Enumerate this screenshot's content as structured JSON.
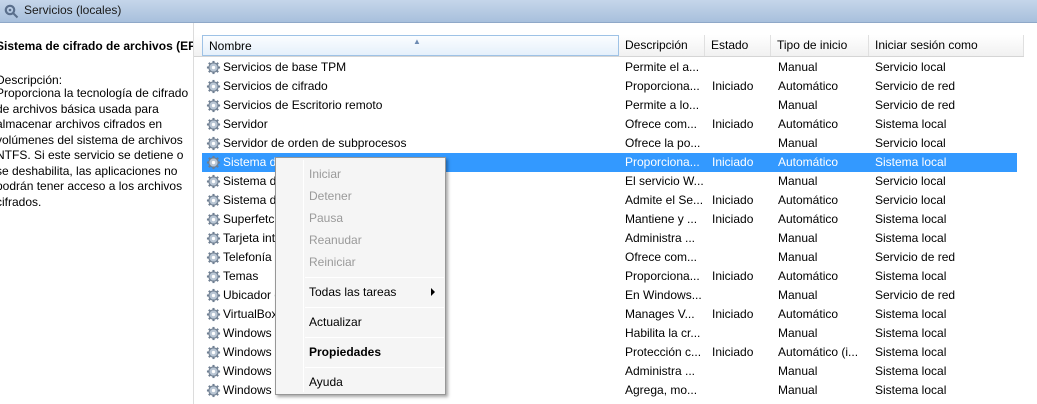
{
  "header": {
    "title": "Servicios (locales)"
  },
  "left_pane": {
    "service_title": "Sistema de cifrado de archivos (EFS)",
    "description_label": "Descripción:",
    "description_text": "Proporciona la tecnología de cifrado de archivos básica usada para almacenar archivos cifrados en volúmenes del sistema de archivos NTFS. Si este servicio se detiene o se deshabilita, las aplicaciones no podrán tener acceso a los archivos cifrados."
  },
  "columns": {
    "name": "Nombre",
    "description": "Descripción",
    "state": "Estado",
    "start_type": "Tipo de inicio",
    "login": "Iniciar sesión como"
  },
  "rows": [
    {
      "name": "Servicios de base TPM",
      "description": "Permite el a...",
      "state": "",
      "start_type": "Manual",
      "login": "Servicio local"
    },
    {
      "name": "Servicios de cifrado",
      "description": "Proporciona...",
      "state": "Iniciado",
      "start_type": "Automático",
      "login": "Servicio de red"
    },
    {
      "name": "Servicios de Escritorio remoto",
      "description": "Permite a lo...",
      "state": "",
      "start_type": "Manual",
      "login": "Servicio de red"
    },
    {
      "name": "Servidor",
      "description": "Ofrece com...",
      "state": "Iniciado",
      "start_type": "Automático",
      "login": "Sistema local"
    },
    {
      "name": "Servidor de orden de subprocesos",
      "description": "Ofrece la po...",
      "state": "",
      "start_type": "Manual",
      "login": "Servicio local"
    },
    {
      "name": "Sistema de cifrado de archivos (EFS)",
      "description": "Proporciona...",
      "state": "Iniciado",
      "start_type": "Automático",
      "login": "Sistema local"
    },
    {
      "name": "Sistema d",
      "description": "El servicio W...",
      "state": "",
      "start_type": "Manual",
      "login": "Servicio local"
    },
    {
      "name": "Sistema d",
      "description": "Admite el Se...",
      "state": "Iniciado",
      "start_type": "Automático",
      "login": "Servicio local"
    },
    {
      "name": "Superfetch",
      "description": "Mantiene y ...",
      "state": "Iniciado",
      "start_type": "Automático",
      "login": "Sistema local"
    },
    {
      "name": "Tarjeta int",
      "description": "Administra ...",
      "state": "",
      "start_type": "Manual",
      "login": "Sistema local"
    },
    {
      "name": "Telefonía",
      "description": "Ofrece com...",
      "state": "",
      "start_type": "Manual",
      "login": "Servicio de red"
    },
    {
      "name": "Temas",
      "description": "Proporciona...",
      "state": "Iniciado",
      "start_type": "Automático",
      "login": "Sistema local"
    },
    {
      "name": "Ubicador                                          oto (RPC)",
      "description": "En Windows...",
      "state": "",
      "start_type": "Manual",
      "login": "Servicio de red"
    },
    {
      "name": "VirtualBox",
      "description": "Manages V...",
      "state": "Iniciado",
      "start_type": "Automático",
      "login": "Sistema local"
    },
    {
      "name": "Windows",
      "description": "Habilita la cr...",
      "state": "",
      "start_type": "Manual",
      "login": "Sistema local"
    },
    {
      "name": "Windows",
      "description": "Protección c...",
      "state": "Iniciado",
      "start_type": "Automático (i...",
      "login": "Sistema local"
    },
    {
      "name": "Windows                                           Driver Framework",
      "description": "Administra ...",
      "state": "",
      "start_type": "Manual",
      "login": "Sistema local"
    },
    {
      "name": "Windows",
      "description": "Agrega, mo...",
      "state": "",
      "start_type": "Manual",
      "login": "Sistema local"
    }
  ],
  "context_menu": {
    "start": "Iniciar",
    "stop": "Detener",
    "pause": "Pausa",
    "resume": "Reanudar",
    "restart": "Reiniciar",
    "all_tasks": "Todas las tareas",
    "refresh": "Actualizar",
    "properties": "Propiedades",
    "help": "Ayuda"
  },
  "colors": {
    "selection": "#3399ff",
    "header_band": "#b6cbe3"
  }
}
